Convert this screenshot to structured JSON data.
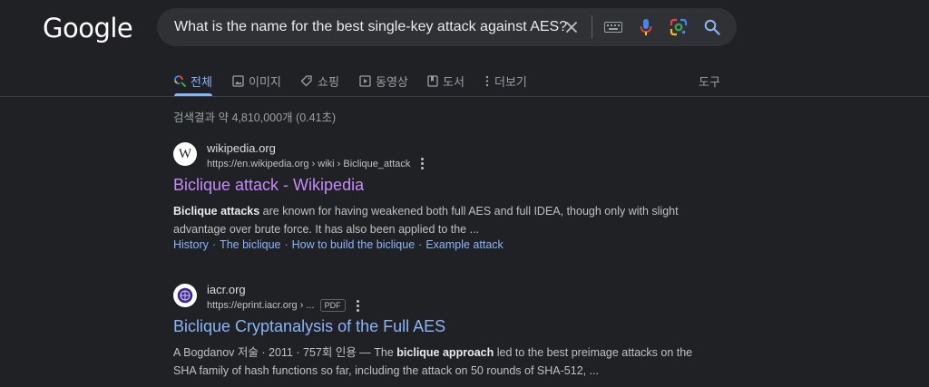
{
  "header": {
    "logo_text": "Google",
    "search_query": "What is the name for the best single-key attack against AES?",
    "icons": [
      "clear-icon",
      "keyboard-icon",
      "voice-search-icon",
      "lens-icon",
      "search-icon"
    ]
  },
  "tabs": {
    "all": "전체",
    "images": "이미지",
    "shopping": "쇼핑",
    "videos": "동영상",
    "books": "도서",
    "more": "더보기",
    "tools": "도구"
  },
  "stats": "검색결과 약 4,810,000개 (0.41초)",
  "results": [
    {
      "site_name": "wikipedia.org",
      "url": "https://en.wikipedia.org › wiki › Biclique_attack",
      "favicon_text": "W",
      "title": "Biclique attack - Wikipedia",
      "snippet_bold": "Biclique attacks",
      "snippet_rest": " are known for having weakened both full AES and full IDEA, though only with slight advantage over brute force. It has also been applied to the ...",
      "sitelinks": [
        "History",
        "The biclique",
        "How to build the biclique",
        "Example attack"
      ]
    },
    {
      "site_name": "iacr.org",
      "url": "https://eprint.iacr.org › ...",
      "badge": "PDF",
      "title": "Biclique Cryptanalysis of the Full AES",
      "snippet_meta": "A Bogdanov 저술 · 2011 · 757회 인용 — The ",
      "snippet_bold": "biclique approach",
      "snippet_rest": " led to the best preimage attacks on the SHA family of hash functions so far, including the attack on 50 rounds of SHA-512, ..."
    }
  ],
  "colors": {
    "background": "#202124",
    "link": "#8ab4f8",
    "visited": "#c58af9",
    "text": "#bdc1c6"
  }
}
